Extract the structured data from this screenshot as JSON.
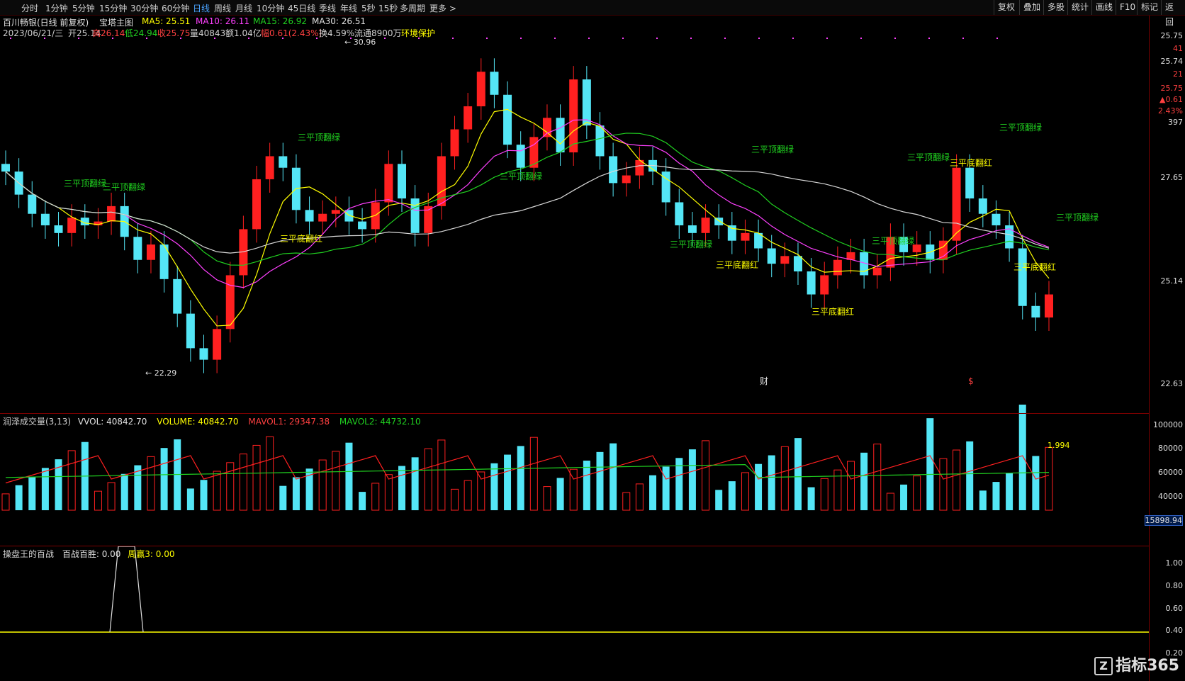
{
  "toolbar": {
    "left": [
      "分时",
      "1分钟",
      "5分钟",
      "15分钟",
      "30分钟",
      "60分钟",
      "日线",
      "周线",
      "月线",
      "10分钟",
      "45日线",
      "季线",
      "年线",
      "5秒",
      "15秒",
      "多周期",
      "更多 >"
    ],
    "active": "日线",
    "right": [
      "复权",
      "叠加",
      "多股",
      "统计",
      "画线",
      "F10",
      "标记",
      "返回"
    ]
  },
  "header": {
    "stock": "百川畅银(日线 前复权)",
    "indicator": "宝塔主图",
    "ma5": "MA5: 25.51",
    "ma10": "MA10: 26.11",
    "ma15": "MA15: 26.92",
    "ma30": "MA30: 26.51",
    "date": "2023/06/21/三",
    "open": "开25.14",
    "high": "高26.14",
    "low": "低24.94",
    "close": "收25.75",
    "vol": "量40843",
    "amount": "额1.04亿",
    "change": "幅0.61(2.43%)",
    "turnover": "换4.59%",
    "float": "流通8900万",
    "env": "环境保护"
  },
  "chart_data": {
    "type": "candlestick",
    "price_axis": [
      "27.65",
      "25.14",
      "22.63"
    ],
    "high_label": "30.96",
    "low_label": "22.29",
    "signals": {
      "top_green": "三平顶翻绿",
      "bottom_red": "三平底翻红"
    },
    "markers": {
      "fin": "财",
      "dollar": "$"
    }
  },
  "axis_info": {
    "price": "25.75",
    "n1": "41",
    "price2": "25.74",
    "n2": "21",
    "last": "25.75",
    "chg": "▲0.61",
    "pct": "2.43%",
    "n3": "397"
  },
  "volume": {
    "name": "润泽成交量(3,13)",
    "vvol": "VVOL: 40842.70",
    "volume": "VOLUME: 40842.70",
    "mavol1": "MAVOL1: 29347.38",
    "mavol2": "MAVOL2: 44732.10",
    "axis": [
      "100000",
      "80000",
      "60000",
      "40000"
    ],
    "cursor": "15898.94",
    "ratio": "1.994"
  },
  "bottom": {
    "name": "操盘王的百战",
    "v1": "百战百胜: 0.00",
    "v2": "周赢3: 0.00",
    "axis": [
      "1.00",
      "0.80",
      "0.60",
      "0.40",
      "0.20"
    ]
  },
  "logo": "指标365",
  "colors": {
    "up": "#ff2020",
    "down": "#54e6f6",
    "ma5": "#ffff00",
    "ma10": "#ff40ff",
    "ma15": "#20d020",
    "ma30": "#d8d8d8"
  }
}
